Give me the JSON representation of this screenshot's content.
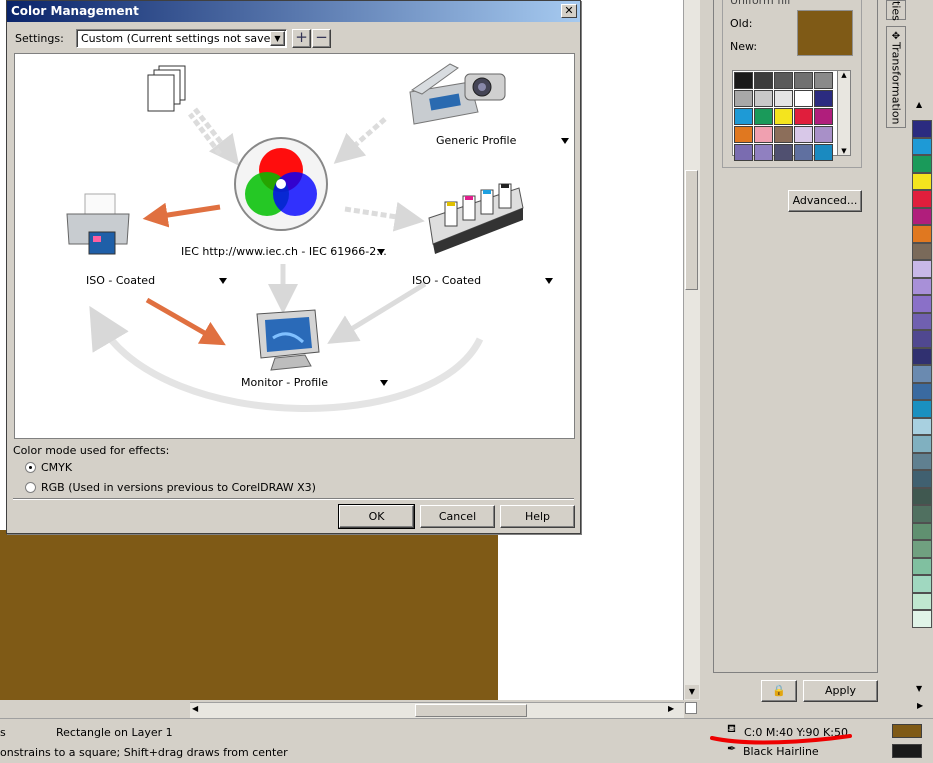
{
  "dialog": {
    "title": "Color Management",
    "settings_label": "Settings:",
    "settings_value": "Custom (Current settings not saved)",
    "add_preset": "+",
    "remove_preset": "−",
    "close_glyph": "✕",
    "profiles": {
      "center": "IEC http://www.iec.ch - IEC 61966-2...",
      "scanner": "Generic Profile",
      "printer": "ISO - Coated",
      "press": "ISO - Coated",
      "monitor": "Monitor - Profile"
    },
    "effects_label": "Color mode used for effects:",
    "effects_options": [
      {
        "label": "CMYK",
        "selected": true
      },
      {
        "label": "RGB (Used in versions previous to CorelDRAW X3)",
        "selected": false
      }
    ],
    "buttons": {
      "ok": "OK",
      "cancel": "Cancel",
      "help": "Help"
    }
  },
  "docker": {
    "fill_type": "Uniform fill",
    "old_label": "Old:",
    "new_label": "New:",
    "old_color": "#7f5a16",
    "advanced_button": "Advanced...",
    "apply_button": "Apply",
    "tabs": [
      "ties",
      "Transformation"
    ],
    "swatches": [
      "#1a1a1a",
      "#3c3c3c",
      "#5a5a5a",
      "#707070",
      "#8a8a8a",
      "#a8a8a8",
      "#c8c8c8",
      "#e4e4e4",
      "#ffffff",
      "#2b2b80",
      "#1e9ad6",
      "#1a9a5a",
      "#f4e41e",
      "#e01e3c",
      "#b01e7c",
      "#e07820",
      "#f0a0b0",
      "#8c6e5a",
      "#d8c8e8",
      "#a890c8",
      "#7a6cb0",
      "#9080c0",
      "#505070",
      "#6070a0",
      "#1a8ac0"
    ]
  },
  "palette_colors": [
    "#2b2b80",
    "#1e9ad6",
    "#1a9a5a",
    "#f4e41e",
    "#e01e3c",
    "#b01e7c",
    "#e07820",
    "#7a6a5a",
    "#c8b8e8",
    "#a890d8",
    "#8a70c8",
    "#7060b0",
    "#504890",
    "#303070",
    "#6a8ab0",
    "#3a6aa0",
    "#1a90c0",
    "#a8d0e0",
    "#80b0c0",
    "#608090",
    "#406070",
    "#405850",
    "#507060",
    "#609070",
    "#70a080",
    "#80c0a0",
    "#a0d8c0",
    "#c0e8d0",
    "#e0f4e8"
  ],
  "status": {
    "object_info": "Rectangle on Layer 1",
    "left_fragment": "s",
    "hint": "onstrains to a square; Shift+drag draws from center",
    "fill_info": "C:0 M:40 Y:90 K:50",
    "outline_info": "Black  Hairline",
    "fill_color": "#7f5a16",
    "outline_color": "#1a1a1a"
  }
}
